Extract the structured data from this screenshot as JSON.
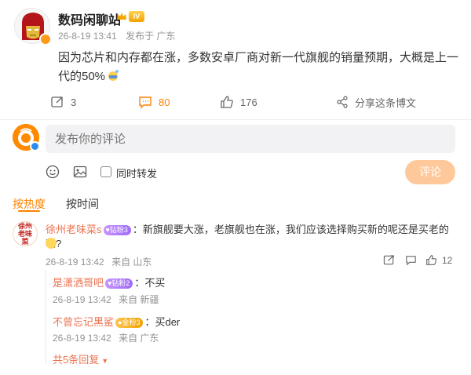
{
  "post": {
    "author": "数码闲聊站",
    "level_badge": "IV",
    "date": "26-8-19 13:41",
    "source": "发布于 广东",
    "text": "因为芯片和内存都在涨，多数安卓厂商对新一代旗舰的销量预期，大概是上一代的50%",
    "actions": {
      "repost_count": "3",
      "comment_count": "80",
      "like_count": "176",
      "share_label": "分享这条博文"
    }
  },
  "composer": {
    "placeholder": "发布你的评论",
    "repost_label": "同时转发",
    "submit_label": "评论"
  },
  "sort_tabs": {
    "hot": "按热度",
    "time": "按时间"
  },
  "top_comment": {
    "avatar_text": "徐州老味菜",
    "author": "徐州老味菜s",
    "badge": "钻粉3",
    "text": "：新旗舰要大涨，老旗舰也在涨，我们应该选择购买新的呢还是买老的呢?",
    "date": "26-8-19 13:42",
    "location": "来自 山东",
    "like_count": "12"
  },
  "replies": [
    {
      "author": "是潇洒哥吧",
      "badge": "钻粉2",
      "text": "：不买",
      "date": "26-8-19 13:42",
      "location": "来自 新疆"
    },
    {
      "author": "不曾忘记黑鲨",
      "badge": "金粉3",
      "text": "：买der",
      "date": "26-8-19 13:42",
      "location": "来自 广东"
    }
  ],
  "more_replies": "共5条回复",
  "colors": {
    "accent": "#ff8200",
    "username": "#eb7350",
    "meta_gray": "#939393",
    "submit_disabled": "#ffc89a"
  }
}
